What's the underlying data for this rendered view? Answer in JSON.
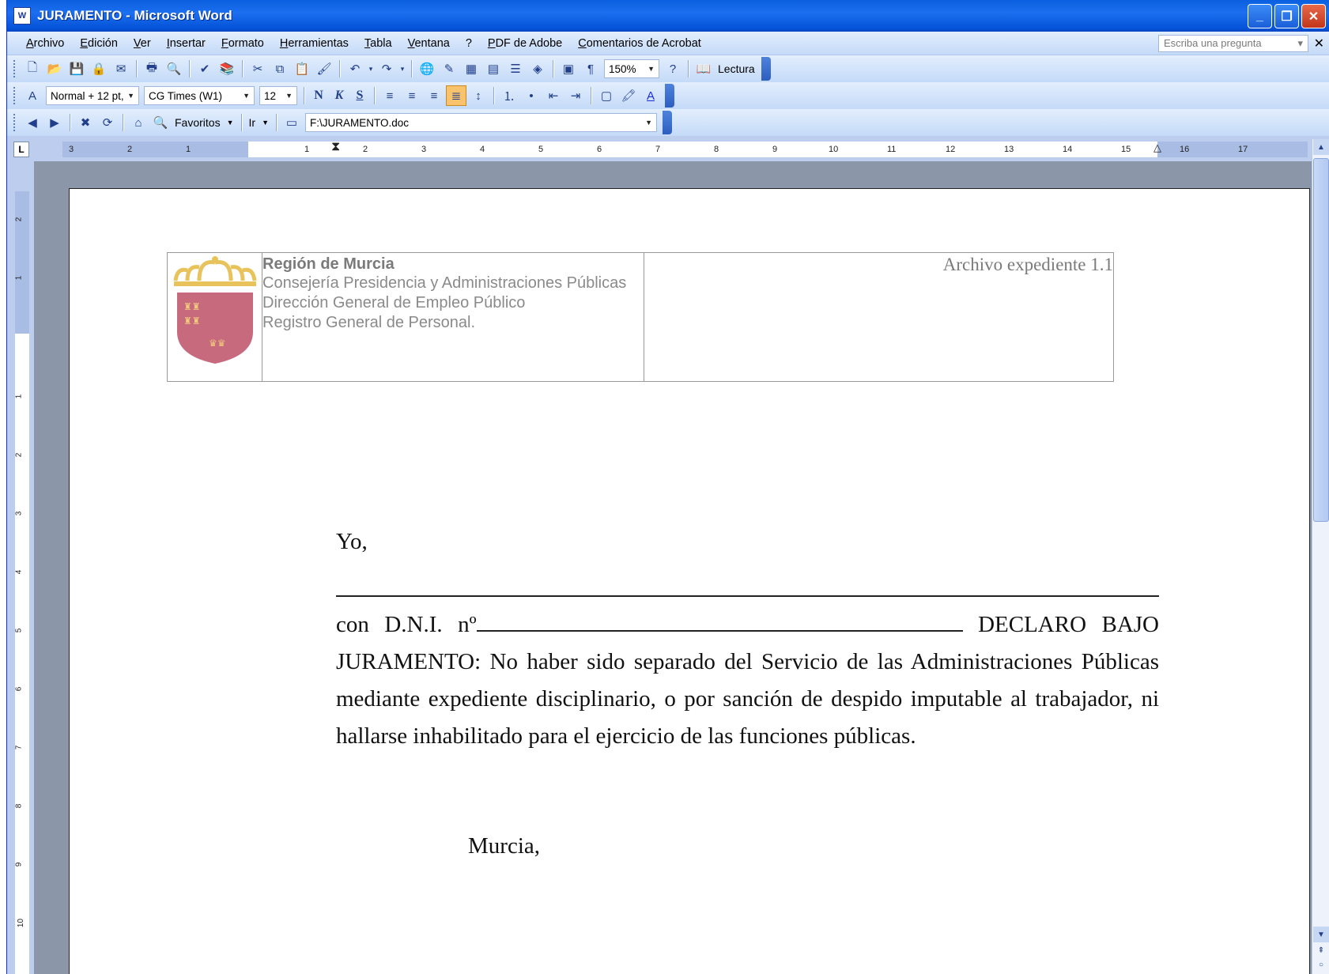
{
  "window": {
    "title": "JURAMENTO - Microsoft Word",
    "app_icon": "word-doc-icon",
    "controls": [
      "minimize-icon",
      "restore-icon",
      "close-icon"
    ]
  },
  "menubar": {
    "items": [
      "Archivo",
      "Edición",
      "Ver",
      "Insertar",
      "Formato",
      "Herramientas",
      "Tabla",
      "Ventana",
      "?",
      "PDF de Adobe",
      "Comentarios de Acrobat"
    ],
    "help_placeholder": "Escriba una pregunta"
  },
  "toolbar_standard": {
    "zoom": "150%",
    "reading_label": "Lectura"
  },
  "toolbar_format": {
    "style": "Normal + 12 pt,",
    "font": "CG Times (W1)",
    "size": "12",
    "bold": "N",
    "italic": "K",
    "underline": "S"
  },
  "toolbar_web": {
    "favorites": "Favoritos",
    "go": "Ir",
    "address": "F:\\JURAMENTO.doc"
  },
  "ruler": {
    "h_ticks": [
      "3",
      "2",
      "1",
      "1",
      "2",
      "3",
      "4",
      "5",
      "6",
      "7",
      "8",
      "9",
      "10",
      "11",
      "12",
      "13",
      "14",
      "15",
      "16",
      "17"
    ],
    "v_ticks": [
      "2",
      "1",
      "1",
      "2",
      "3",
      "4",
      "5",
      "6",
      "7",
      "8",
      "9",
      "10"
    ]
  },
  "document": {
    "header": {
      "org_title": "Región de Murcia",
      "org_lines": [
        "Consejería Presidencia y Administraciones Públicas",
        "Dirección General de Empleo Público",
        "Registro General de Personal."
      ],
      "file_label": "Archivo expediente 1.1"
    },
    "yo": "Yo,",
    "dni_prefix": "con D.N.I. nº",
    "declaration": "DECLARO BAJO JURAMENTO: No haber sido separado del Servicio de las Administraciones Públicas mediante expediente disciplinario, o por sanción de despido imputable al trabajador, ni hallarse inhabilitado para el ejercicio de las funciones públicas.",
    "city": "Murcia,"
  }
}
